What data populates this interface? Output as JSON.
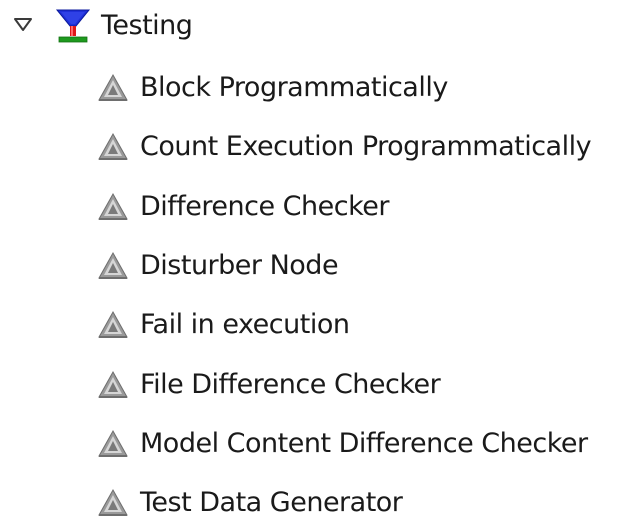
{
  "category": {
    "label": "Testing",
    "expanded": true,
    "icon": "funnel-icon"
  },
  "nodes": [
    {
      "label": "Block Programmatically",
      "icon": "node-triangle-icon"
    },
    {
      "label": "Count Execution Programmatically",
      "icon": "node-triangle-icon"
    },
    {
      "label": "Difference Checker",
      "icon": "node-triangle-icon"
    },
    {
      "label": "Disturber Node",
      "icon": "node-triangle-icon"
    },
    {
      "label": "Fail in execution",
      "icon": "node-triangle-icon"
    },
    {
      "label": "File Difference Checker",
      "icon": "node-triangle-icon"
    },
    {
      "label": "Model Content Difference Checker",
      "icon": "node-triangle-icon"
    },
    {
      "label": "Test Data Generator",
      "icon": "node-triangle-icon"
    }
  ],
  "colors": {
    "funnel_blue": "#1f2fd8",
    "funnel_red": "#e01818",
    "funnel_green": "#1e9a1e",
    "node_icon_gray": "#8a8a8a",
    "text": "#1a1a1a"
  }
}
